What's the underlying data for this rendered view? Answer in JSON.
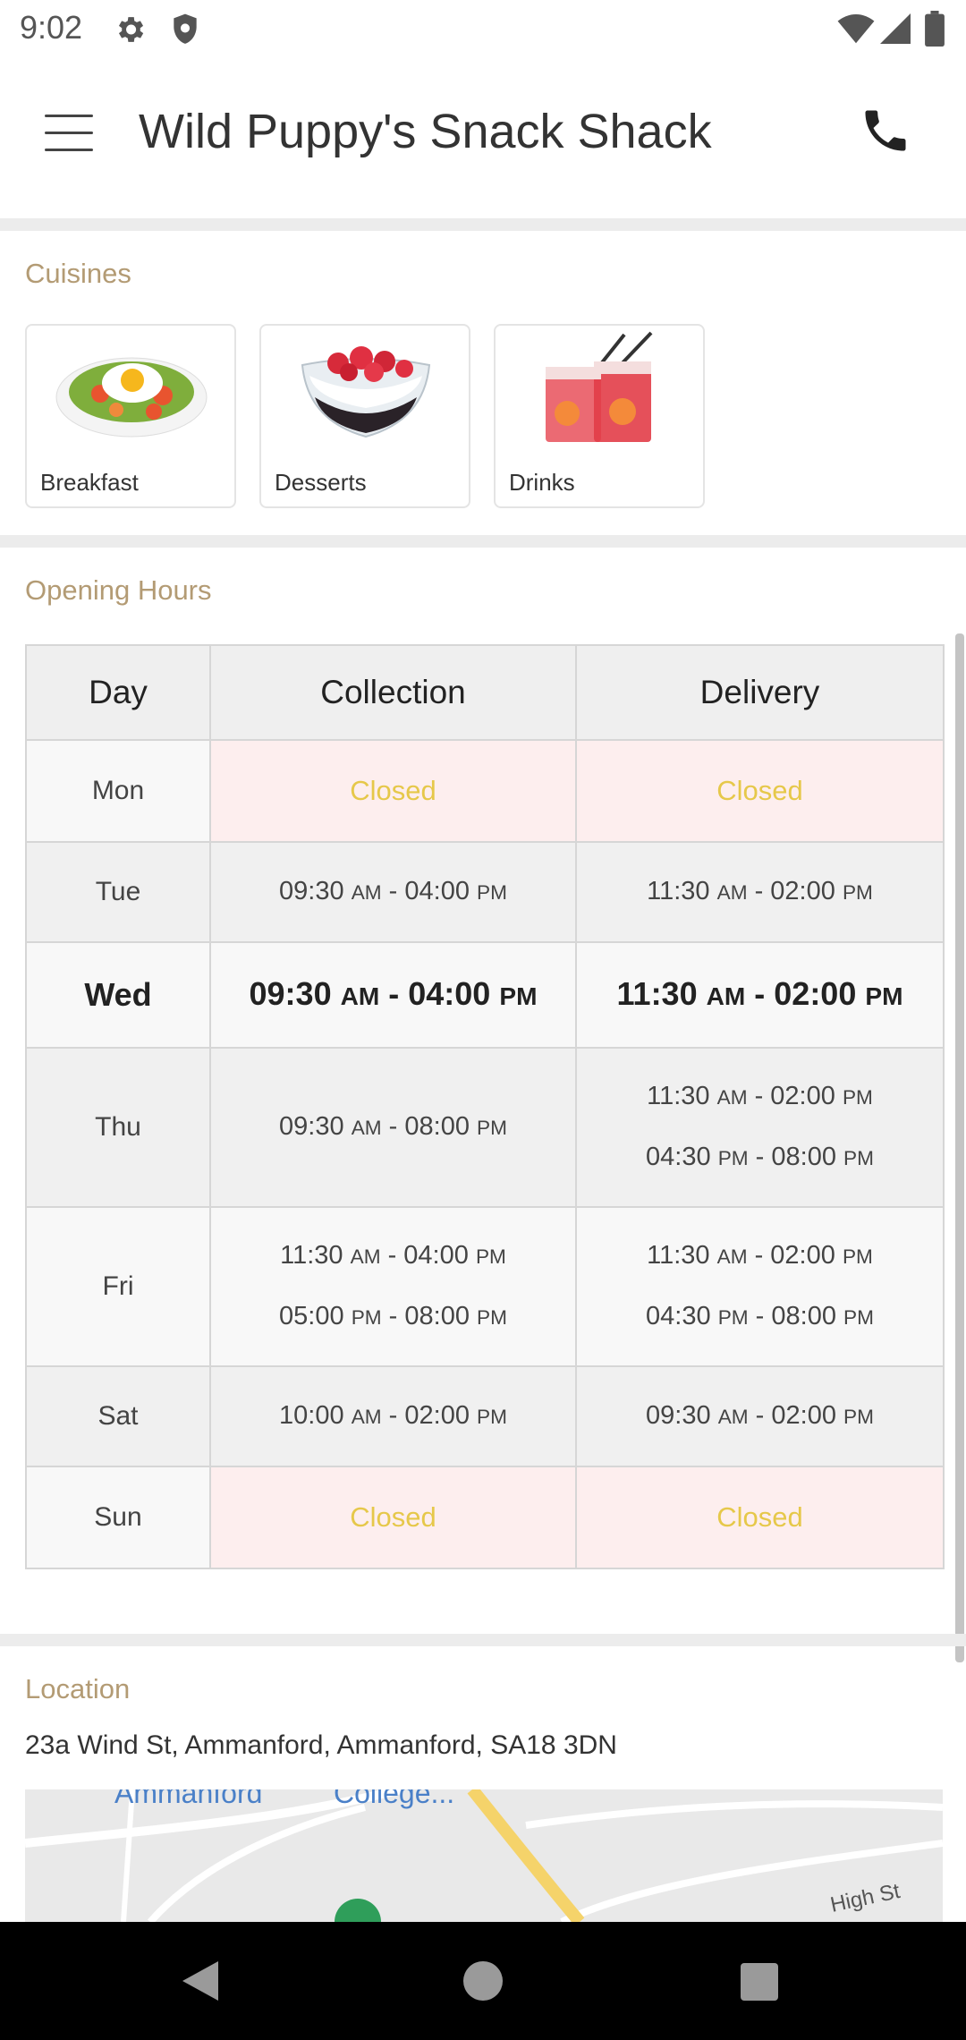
{
  "status_bar": {
    "time": "9:02"
  },
  "app_bar": {
    "title": "Wild Puppy's Snack Shack"
  },
  "cuisines": {
    "heading": "Cuisines",
    "items": [
      {
        "label": "Breakfast"
      },
      {
        "label": "Desserts"
      },
      {
        "label": "Drinks"
      }
    ]
  },
  "opening_hours": {
    "heading": "Opening Hours",
    "columns": [
      "Day",
      "Collection",
      "Delivery"
    ],
    "rows": [
      {
        "day": "Mon",
        "collection": [
          "Closed"
        ],
        "delivery": [
          "Closed"
        ]
      },
      {
        "day": "Tue",
        "collection": [
          "09:30 AM - 04:00 PM"
        ],
        "delivery": [
          "11:30 AM - 02:00 PM"
        ]
      },
      {
        "day": "Wed",
        "collection": [
          "09:30 AM - 04:00 PM"
        ],
        "delivery": [
          "11:30 AM - 02:00 PM"
        ]
      },
      {
        "day": "Thu",
        "collection": [
          "09:30 AM - 08:00 PM"
        ],
        "delivery": [
          "11:30 AM - 02:00 PM",
          "04:30 PM - 08:00 PM"
        ]
      },
      {
        "day": "Fri",
        "collection": [
          "11:30 AM - 04:00 PM",
          "05:00 PM - 08:00 PM"
        ],
        "delivery": [
          "11:30 AM - 02:00 PM",
          "04:30 PM - 08:00 PM"
        ]
      },
      {
        "day": "Sat",
        "collection": [
          "10:00 AM - 02:00 PM"
        ],
        "delivery": [
          "09:30 AM - 02:00 PM"
        ]
      },
      {
        "day": "Sun",
        "collection": [
          "Closed"
        ],
        "delivery": [
          "Closed"
        ]
      }
    ]
  },
  "location": {
    "heading": "Location",
    "address": "23a Wind St, Ammanford, Ammanford, SA18 3DN",
    "map_labels": [
      "Ammanford",
      "College...",
      "High St"
    ]
  },
  "colors": {
    "section_label": "#b39b74",
    "closed_text": "#e6c84a",
    "closed_bg": "#fdeeee"
  }
}
